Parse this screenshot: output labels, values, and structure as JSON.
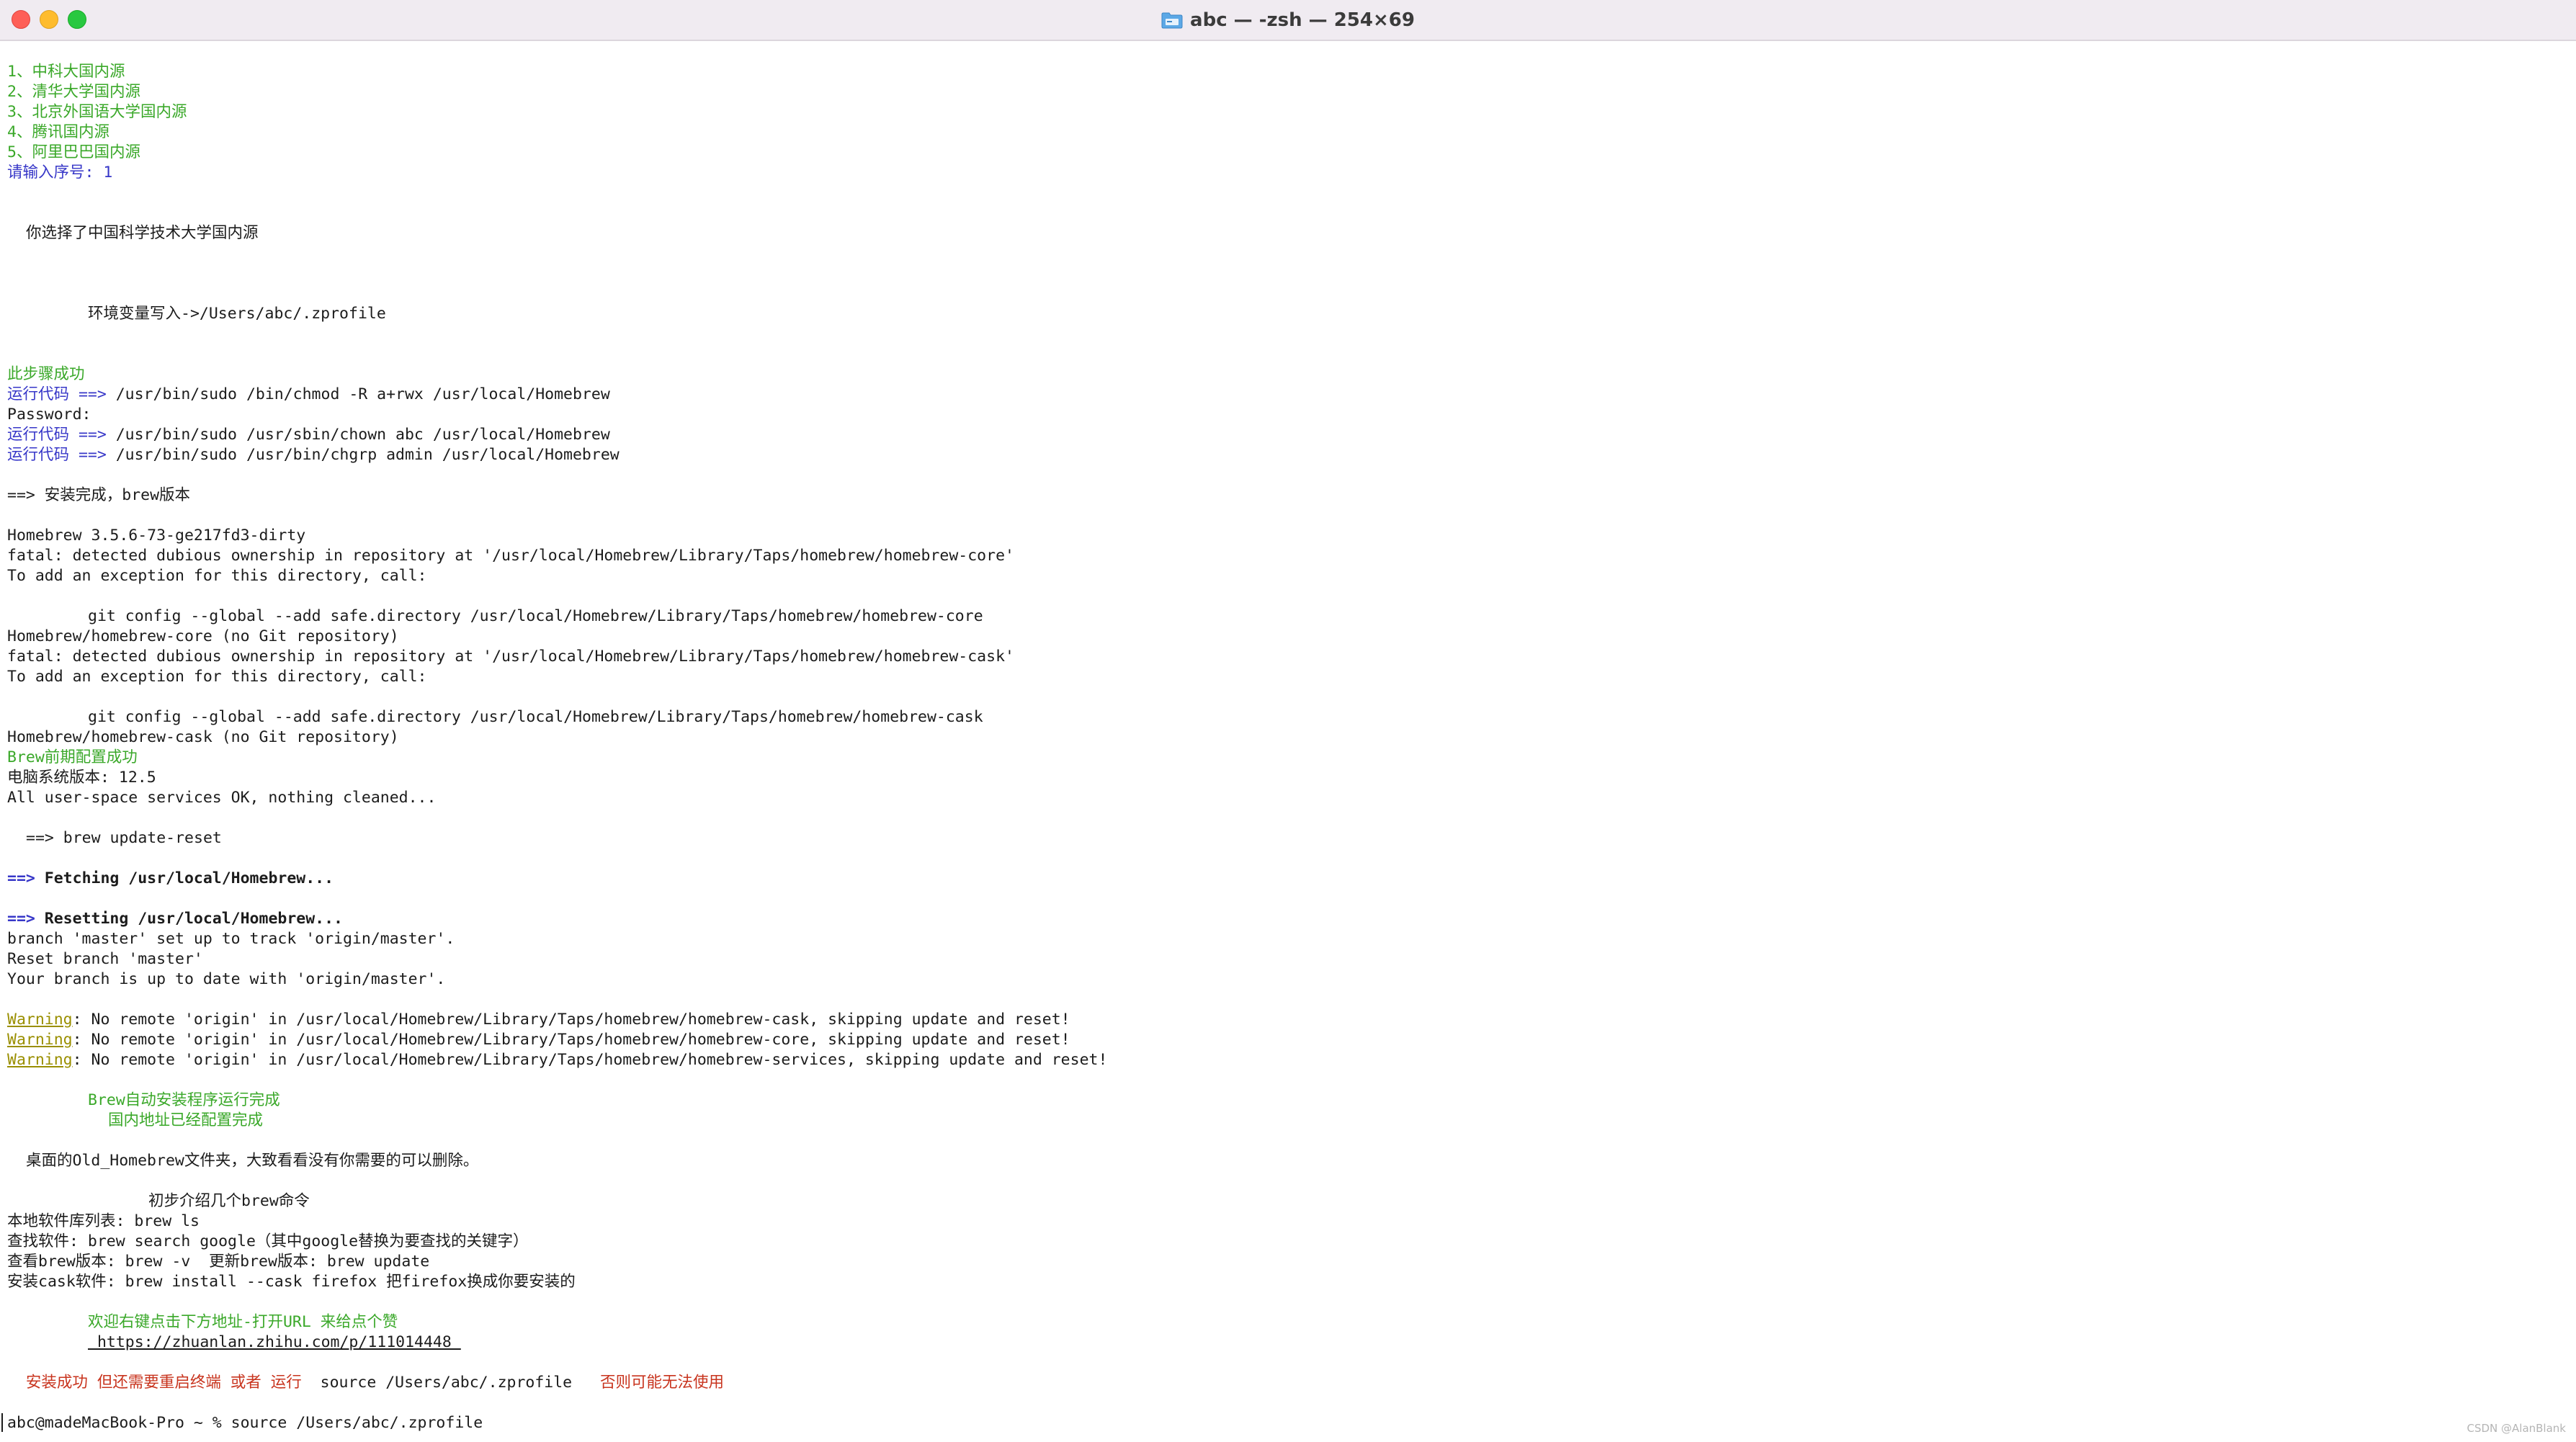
{
  "window": {
    "title": "abc — -zsh — 254×69",
    "folder_icon": "folder-icon",
    "controls": [
      "close",
      "minimize",
      "maximize"
    ]
  },
  "terminal": {
    "menu": [
      "1、中科大国内源",
      "2、清华大学国内源",
      "3、北京外国语大学国内源",
      "4、腾讯国内源",
      "5、阿里巴巴国内源"
    ],
    "prompt_input": "请输入序号: 1",
    "chosen": "你选择了中国科学技术大学国内源",
    "env_write": "环境变量写入->/Users/abc/.zprofile",
    "step_success": "此步骤成功",
    "run_label": "运行代码 ==>",
    "cmd1": " /usr/bin/sudo /bin/chmod -R a+rwx /usr/local/Homebrew",
    "password": "Password:",
    "cmd2": " /usr/bin/sudo /usr/sbin/chown abc /usr/local/Homebrew",
    "cmd3": " /usr/bin/sudo /usr/bin/chgrp admin /usr/local/Homebrew",
    "install_done": "==> 安装完成，brew版本",
    "brew_version": "Homebrew 3.5.6-73-ge217fd3-dirty",
    "fatal_core": "fatal: detected dubious ownership in repository at '/usr/local/Homebrew/Library/Taps/homebrew/homebrew-core'",
    "add_exception_1": "To add an exception for this directory, call:",
    "git_config_core": "git config --global --add safe.directory /usr/local/Homebrew/Library/Taps/homebrew/homebrew-core",
    "no_git_core": "Homebrew/homebrew-core (no Git repository)",
    "fatal_cask": "fatal: detected dubious ownership in repository at '/usr/local/Homebrew/Library/Taps/homebrew/homebrew-cask'",
    "add_exception_2": "To add an exception for this directory, call:",
    "git_config_cask": "git config --global --add safe.directory /usr/local/Homebrew/Library/Taps/homebrew/homebrew-cask",
    "no_git_cask": "Homebrew/homebrew-cask (no Git repository)",
    "pre_config_ok": "Brew前期配置成功",
    "os_version": "电脑系统版本: 12.5",
    "services_ok": "All user-space services OK, nothing cleaned...",
    "update_reset": "==> brew update-reset",
    "arrow": "==>",
    "fetching": " Fetching /usr/local/Homebrew...",
    "resetting": " Resetting /usr/local/Homebrew...",
    "branch_track": "branch 'master' set up to track 'origin/master'.",
    "reset_branch": "Reset branch 'master'",
    "up_to_date": "Your branch is up to date with 'origin/master'.",
    "warning_label": "Warning",
    "warning1": ": No remote 'origin' in /usr/local/Homebrew/Library/Taps/homebrew/homebrew-cask, skipping update and reset!",
    "warning2": ": No remote 'origin' in /usr/local/Homebrew/Library/Taps/homebrew/homebrew-core, skipping update and reset!",
    "warning3": ": No remote 'origin' in /usr/local/Homebrew/Library/Taps/homebrew/homebrew-services, skipping update and reset!",
    "auto_done": "Brew自动安装程序运行完成",
    "mirror_done": "国内地址已经配置完成",
    "old_folder": "桌面的Old_Homebrew文件夹，大致看看没有你需要的可以删除。",
    "intro": "初步介绍几个brew命令",
    "local_list": "本地软件库列表: brew ls",
    "search_sw": "查找软件: brew search google（其中google替换为要查找的关键字）",
    "view_version": "查看brew版本: brew -v  更新brew版本: brew update",
    "install_cask": "安装cask软件: brew install --cask firefox 把firefox换成你要安装的",
    "welcome": "欢迎右键点击下方地址-打开URL 来给点个赞",
    "url": " https://zhuanlan.zhihu.com/p/111014448 ",
    "final_warn_a": "安装成功 但还需要重启终端 或者 运行",
    "final_cmd": "source /Users/abc/.zprofile",
    "final_warn_b": "否则可能无法使用",
    "shell_prompt": "abc@madeMacBook-Pro ~ % source /Users/abc/.zprofile"
  },
  "watermark": "CSDN @AlanBlank",
  "colors": {
    "green": "#3aa829",
    "blue": "#3737c8",
    "warning_yellow": "#9a8f00",
    "red": "#c8341e",
    "titlebar": "#f0ebf1"
  }
}
